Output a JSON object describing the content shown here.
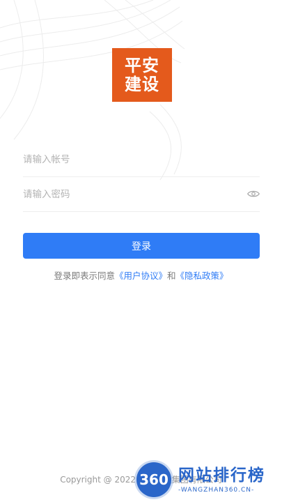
{
  "logo": {
    "line1": "平安",
    "line2": "建设",
    "color": "#e45a1c"
  },
  "form": {
    "account_placeholder": "请输入帐号",
    "password_placeholder": "请输入密码"
  },
  "login_button": {
    "label": "登录",
    "color": "#2f7cf6"
  },
  "agreement": {
    "prefix": "登录即表示同意",
    "user_agreement": "《用户协议》",
    "conjunction": "和",
    "privacy_policy": "《隐私政策》"
  },
  "footer": {
    "copyright": "Copyright @ 2022 平安建设集团有限公司"
  },
  "watermark": {
    "badge": "360",
    "title": "网站排行榜",
    "subtitle": "-WANGZHAN360.CN-"
  },
  "icons": {
    "password_toggle": "eye-icon"
  }
}
